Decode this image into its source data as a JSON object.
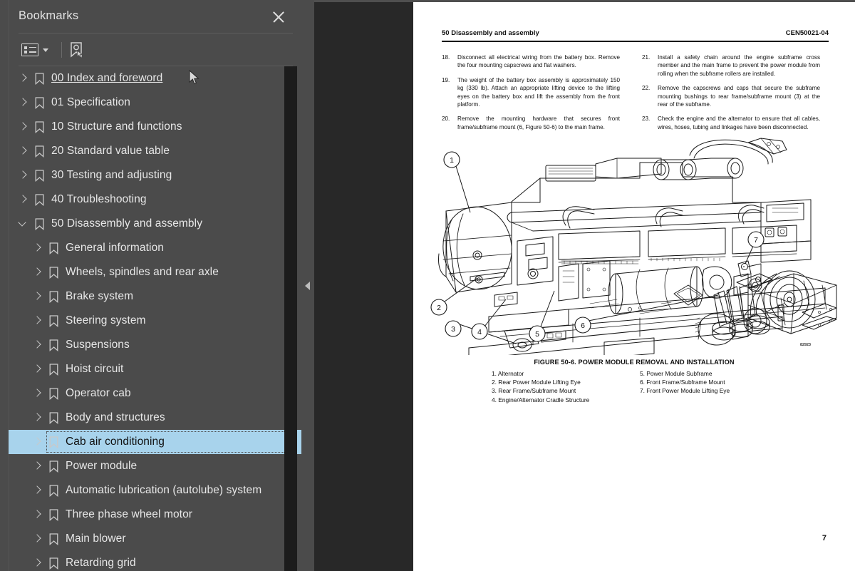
{
  "panel": {
    "title": "Bookmarks",
    "close_label": "Close",
    "toolbar": {
      "list_options_label": "Bookmark list options",
      "new_bookmark_label": "New bookmark"
    },
    "items": [
      {
        "label": "00 Index and foreword",
        "level": 1,
        "expanded": false,
        "state": "hover"
      },
      {
        "label": "01 Specification",
        "level": 1,
        "expanded": false,
        "state": "normal"
      },
      {
        "label": "10 Structure and functions",
        "level": 1,
        "expanded": false,
        "state": "normal"
      },
      {
        "label": "20 Standard value table",
        "level": 1,
        "expanded": false,
        "state": "normal"
      },
      {
        "label": "30 Testing and adjusting",
        "level": 1,
        "expanded": false,
        "state": "normal"
      },
      {
        "label": "40 Troubleshooting",
        "level": 1,
        "expanded": false,
        "state": "normal"
      },
      {
        "label": "50 Disassembly and assembly",
        "level": 1,
        "expanded": true,
        "state": "normal"
      },
      {
        "label": "General information",
        "level": 2,
        "expanded": false,
        "state": "normal"
      },
      {
        "label": "Wheels, spindles and rear axle",
        "level": 2,
        "expanded": false,
        "state": "normal"
      },
      {
        "label": "Brake system",
        "level": 2,
        "expanded": false,
        "state": "normal"
      },
      {
        "label": "Steering system",
        "level": 2,
        "expanded": false,
        "state": "normal"
      },
      {
        "label": "Suspensions",
        "level": 2,
        "expanded": false,
        "state": "normal"
      },
      {
        "label": "Hoist circuit",
        "level": 2,
        "expanded": false,
        "state": "normal"
      },
      {
        "label": "Operator cab",
        "level": 2,
        "expanded": false,
        "state": "normal"
      },
      {
        "label": "Body and structures",
        "level": 2,
        "expanded": false,
        "state": "normal"
      },
      {
        "label": "Cab air conditioning",
        "level": 2,
        "expanded": false,
        "state": "selected"
      },
      {
        "label": "Power module",
        "level": 2,
        "expanded": false,
        "state": "normal"
      },
      {
        "label": "Automatic lubrication (autolube) system",
        "level": 2,
        "expanded": false,
        "state": "normal"
      },
      {
        "label": "Three phase wheel motor",
        "level": 2,
        "expanded": false,
        "state": "normal"
      },
      {
        "label": "Main blower",
        "level": 2,
        "expanded": false,
        "state": "normal"
      },
      {
        "label": "Retarding grid",
        "level": 2,
        "expanded": false,
        "state": "normal"
      }
    ],
    "selection_color": "#a8d3ec",
    "background_color": "#4b4b4b"
  },
  "collapse": {
    "label": "Collapse panel"
  },
  "document": {
    "header_left": "50 Disassembly and assembly",
    "header_right": "CEN50021-04",
    "page_number": "7",
    "figure_id": "82923",
    "left_column": [
      {
        "num": "18.",
        "text": "Disconnect all electrical wiring from the battery box. Remove the four mounting capscrews and flat washers."
      },
      {
        "num": "19.",
        "text": "The weight of the battery box assembly is approximately 150 kg (330 lb). Attach an appropriate lifting device to the lifting eyes on the battery box and lift the assembly from the front platform."
      },
      {
        "num": "20.",
        "text": "Remove the mounting hardware that secures front frame/subframe mount (6, Figure 50-6) to the main frame."
      }
    ],
    "right_column": [
      {
        "num": "21.",
        "text": "Install a safety chain around the engine subframe cross member and the main frame to prevent the power module from rolling when the subframe rollers are installed."
      },
      {
        "num": "22.",
        "text": "Remove the capscrews and caps that secure the subframe mounting bushings to rear frame/subframe mount (3) at the rear of the subframe."
      },
      {
        "num": "23.",
        "text": "Check the engine and the alternator to ensure that all cables, wires, hoses, tubing and linkages have been disconnected."
      }
    ],
    "figure_caption": "FIGURE 50-6. POWER MODULE REMOVAL AND INSTALLATION",
    "legend_left": [
      "1. Alternator",
      "2. Rear Power Module Lifting Eye",
      "3. Rear Frame/Subframe Mount",
      "4. Engine/Alternator Cradle Structure"
    ],
    "legend_right": [
      "5. Power Module Subframe",
      "6. Front Frame/Subframe Mount",
      "7. Front Power Module Lifting Eye"
    ],
    "callouts": [
      "1",
      "2",
      "3",
      "4",
      "5",
      "6",
      "7"
    ]
  }
}
